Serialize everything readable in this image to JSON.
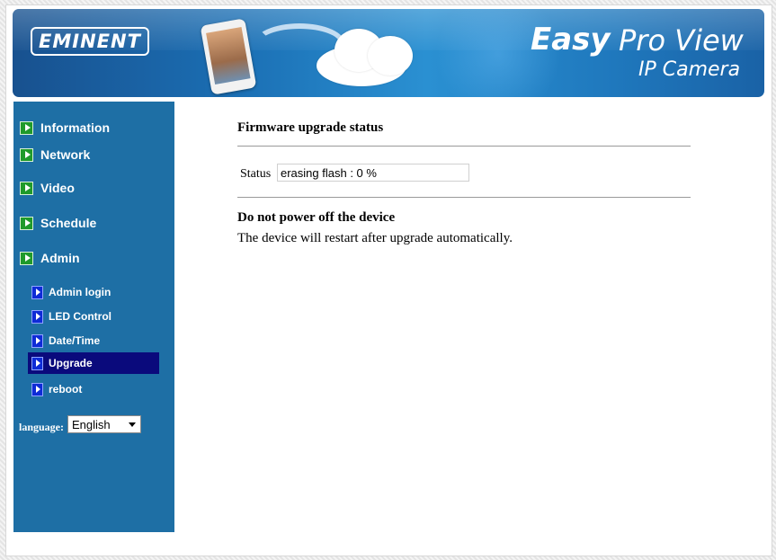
{
  "header": {
    "logo_text": "EMINENT",
    "title_easy": "Easy",
    "title_proview": "Pro View",
    "title_sub": "IP Camera"
  },
  "sidebar": {
    "items": [
      {
        "label": "Information"
      },
      {
        "label": "Network"
      },
      {
        "label": "Video"
      },
      {
        "label": "Schedule"
      },
      {
        "label": "Admin"
      }
    ],
    "admin_items": [
      {
        "label": "Admin login"
      },
      {
        "label": "LED Control"
      },
      {
        "label": "Date/Time"
      },
      {
        "label": "Upgrade",
        "active": true
      },
      {
        "label": "reboot"
      }
    ],
    "language_label": "language:",
    "language_value": "English"
  },
  "main": {
    "section_title": "Firmware upgrade status",
    "status_label": "Status",
    "status_value": "erasing flash : 0 %",
    "warning_title": "Do not power off the device",
    "warning_text": "The device will restart after upgrade automatically."
  },
  "colors": {
    "sidebar_bg": "#1e6fa5",
    "active_item_bg": "#0a0a7c",
    "banner_blue": "#1b6fb4"
  }
}
